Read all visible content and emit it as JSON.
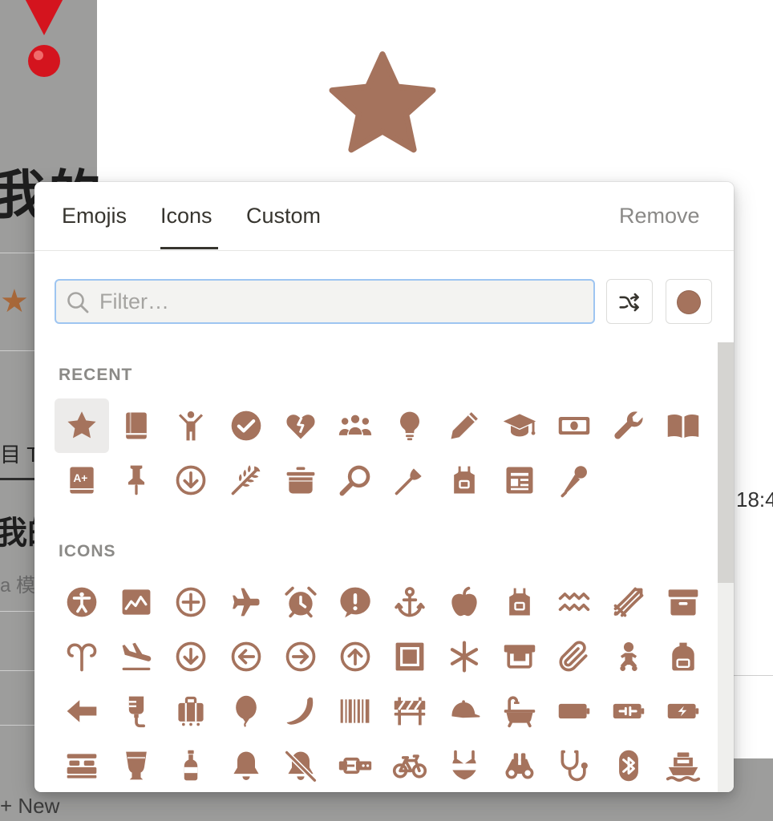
{
  "background": {
    "heading_fragment": "我的",
    "tab_fragment": "目 T",
    "title_fragment": "我的",
    "subtitle_fragment": "a 模",
    "time_fragment": "18:4",
    "new_label": "+ New"
  },
  "page_icon": "star-icon",
  "picker": {
    "tabs": [
      "Emojis",
      "Icons",
      "Custom"
    ],
    "active_tab": "Icons",
    "remove_label": "Remove",
    "search": {
      "placeholder": "Filter…",
      "value": ""
    },
    "shuffle_icon": "shuffle-icon",
    "selected_color": "#a5735d",
    "recent_label": "RECENT",
    "icons_label": "ICONS",
    "recent": [
      "star",
      "book-closed",
      "person-raising-hand",
      "checkmark-circle",
      "heart-broken",
      "people-group",
      "lightbulb",
      "pencil",
      "graduation-cap",
      "banknote",
      "wrench",
      "book-open",
      "book-grade",
      "pushpin",
      "arrow-down-circle",
      "wheat",
      "cooking-pot",
      "frying-pan",
      "fork",
      "apron",
      "newspaper",
      "microphone"
    ],
    "icons": [
      "accessibility",
      "activity",
      "add-circle",
      "airplane",
      "alarm",
      "alert-bubble",
      "anchor",
      "apple",
      "apron",
      "aquarius",
      "archery",
      "archive",
      "aries",
      "arrival",
      "arrow-down-circle",
      "arrow-left-circle",
      "arrow-right-circle",
      "arrow-up-circle",
      "artwork",
      "asterisk",
      "atm",
      "attachment",
      "baby",
      "backpack",
      "arrow-left",
      "iv-bag",
      "baggage",
      "balloon",
      "banana",
      "barcode",
      "barricade",
      "baseball-cap",
      "bathtub",
      "battery",
      "battery-charging",
      "battery-bolt",
      "bed",
      "beer",
      "bottle",
      "bell",
      "bell-off",
      "belt",
      "bicycle",
      "bikini",
      "binoculars",
      "stethoscope",
      "bluetooth",
      "boat"
    ],
    "icon_color": "#a5735d"
  }
}
